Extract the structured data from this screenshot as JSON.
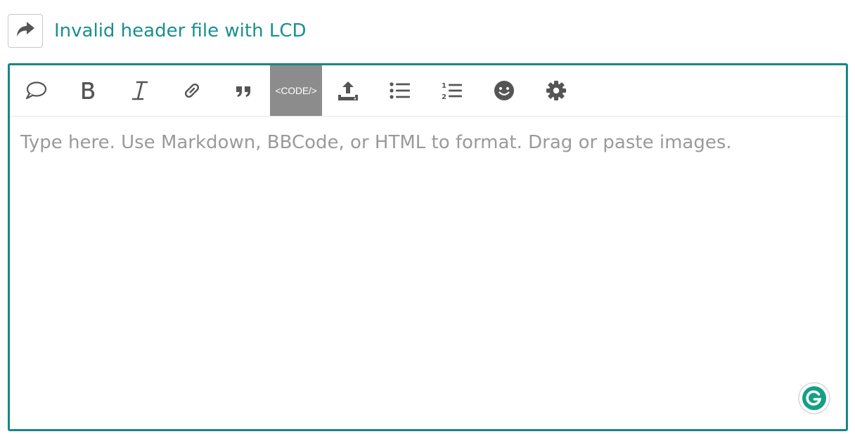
{
  "reply_header": {
    "topic_title": "Invalid header file with LCD",
    "reply_icon": "share-arrow-icon"
  },
  "toolbar": {
    "buttons": [
      {
        "name": "quote-reply-icon"
      },
      {
        "name": "bold-icon"
      },
      {
        "name": "italic-icon"
      },
      {
        "name": "link-icon"
      },
      {
        "name": "blockquote-icon"
      },
      {
        "name": "code-icon",
        "label": "<CODE/>"
      },
      {
        "name": "upload-icon"
      },
      {
        "name": "bulleted-list-icon"
      },
      {
        "name": "numbered-list-icon"
      },
      {
        "name": "emoji-icon"
      },
      {
        "name": "gear-icon"
      }
    ]
  },
  "editor": {
    "placeholder": "Type here. Use Markdown, BBCode, or HTML to format. Drag or paste images.",
    "value": ""
  },
  "grammarly": {
    "icon": "grammarly-icon"
  },
  "colors": {
    "accent": "#158787",
    "title": "#1a8f8f",
    "code_bg": "#8c8c8c"
  }
}
